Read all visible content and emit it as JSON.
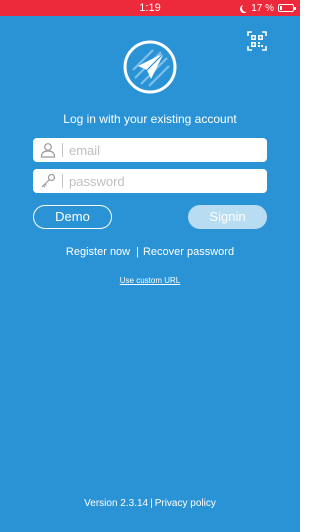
{
  "status_bar": {
    "time": "1:19",
    "battery_text": "17 %",
    "battery_level": 0.17,
    "icons": [
      "moon-icon",
      "battery-icon"
    ],
    "color": "#ed2a3b"
  },
  "header": {
    "qr_icon": "qr-code-icon",
    "logo_icon": "compass-arrow-logo"
  },
  "login": {
    "subtitle": "Log in with your existing account",
    "email_placeholder": "email",
    "password_placeholder": "password",
    "email_icon": "user-icon",
    "password_icon": "key-icon",
    "demo_label": "Demo",
    "signin_label": "Signin"
  },
  "links": {
    "register": "Register now",
    "separator": "|",
    "recover": "Recover password",
    "custom_url": "Use custom URL"
  },
  "footer": {
    "version": "Version 2.3.14",
    "separator": "|",
    "privacy": "Privacy policy"
  },
  "colors": {
    "background": "#2a93d6",
    "signin_button": "#b8dcf2",
    "text": "#ffffff"
  }
}
